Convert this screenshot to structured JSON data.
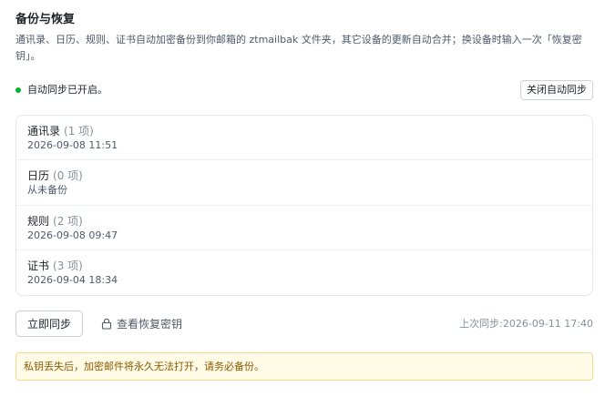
{
  "section": {
    "title": "备份与恢复",
    "description": "通讯录、日历、规则、证书自动加密备份到你邮箱的 ztmailbak 文件夹，其它设备的更新自动合并；换设备时输入一次「恢复密钥」。"
  },
  "status": {
    "text": "自动同步已开启。",
    "dot_color": "#00b42a",
    "toggle_button_label": "关闭自动同步"
  },
  "items": [
    {
      "name": "通讯录",
      "count": "(1 项)",
      "time": "2026-09-08 11:51"
    },
    {
      "name": "日历",
      "count": "(0 项)",
      "time": "从未备份"
    },
    {
      "name": "规则",
      "count": "(2 项)",
      "time": "2026-09-08 09:47"
    },
    {
      "name": "证书",
      "count": "(3 项)",
      "time": "2026-09-04 18:34"
    }
  ],
  "actions": {
    "sync_now_label": "立即同步",
    "view_key_label": "查看恢复密钥",
    "view_key_icon": "lock-icon",
    "last_sync_text": "上次同步:2026-09-11 17:40"
  },
  "warning": {
    "text": "私钥丢失后，加密邮件将永久无法打开，请务必备份。",
    "bg_color": "#fffbe6",
    "border_color": "#f5dc8a"
  }
}
